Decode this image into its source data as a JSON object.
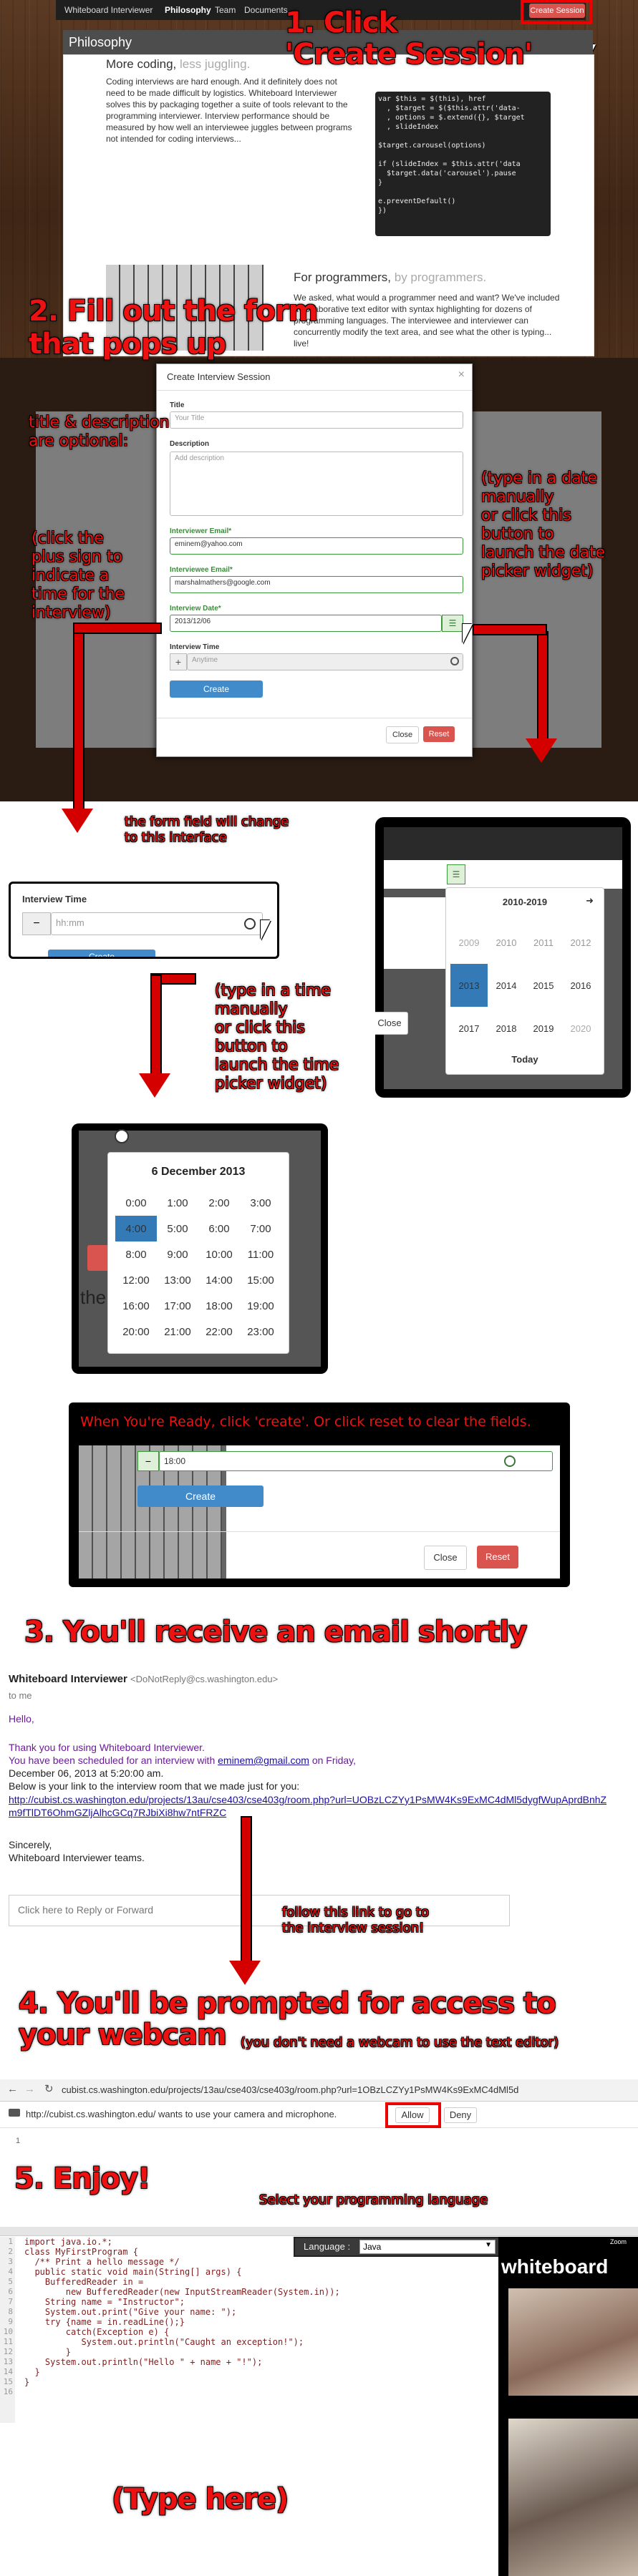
{
  "steps": {
    "s1": "1. Click\n'Create Session'",
    "s2": "2. Fill out the form\nthat pops up",
    "s3": "3. You'll receive an email shortly",
    "s4": "4. You'll be prompted for access to\nyour webcam",
    "s5": "5. Enjoy!"
  },
  "notes": {
    "title_optional": "title & description\nare optional:",
    "plus_sign": "(click the\nplus sign to\nindicate a\ntime for the\ninterview)",
    "date_type": "(type in a date\nmanually\nor click this\nbutton to\nlaunch the date\npicker widget)",
    "form_change": "the form field will change\nto this interface",
    "time_type": "(type in a time\nmanually\nor click this\nbutton to\nlaunch the time\npicker widget)",
    "ready": "When You're Ready, click 'create'. Or click reset to clear the fields.",
    "follow_link": "follow this link to go to\nthe interview session!",
    "webcam_note": "(you don't need a webcam to use the text editor)",
    "select_lang": "Select your programming language",
    "type_here": "(Type here)"
  },
  "site": {
    "brand": "Whiteboard Interviewer",
    "nav": [
      "Philosophy",
      "Team",
      "Documents"
    ],
    "create_session": "Create Session",
    "section_title": "Philosophy",
    "h_more": "More coding,",
    "h_more_sub": " less juggling.",
    "p_more": "Coding interviews are hard enough. And it definitely does not need to be made difficult by logistics. Whiteboard Interviewer solves this by packaging together a suite of tools relevant to the programming interviewer. Interview performance should be measured by how well an interviewee juggles between programs not intended for coding interviews...",
    "h_prog": "For programmers,",
    "h_prog_sub": " by programmers.",
    "p_prog": "We asked, what would a programmer need and want? We've included a collaborative text editor with syntax highlighting for dozens of programming languages. The interviewee and interviewer can concurrently modify the text area, and see what the other is typing... live!",
    "code_lines": "var $this = $(this), href\n  , $target = $($this.attr('data-\n  , options = $.extend({}, $target\n  , slideIndex\n\n$target.carousel(options)\n\nif (slideIndex = $this.attr('data\n  $target.data('carousel').pause\n}\n\ne.preventDefault()\n})"
  },
  "modal": {
    "title": "Create Interview Session",
    "close_x": "×",
    "title_label": "Title",
    "title_placeholder": "Your Title",
    "desc_label": "Description",
    "desc_placeholder": "Add description",
    "er_label": "Interviewer Email*",
    "er_value": "eminem@yahoo.com",
    "ee_label": "Interviewee Email*",
    "ee_value": "marshalmathers@google.com",
    "date_label": "Interview Date*",
    "date_value": "2013/12/06",
    "time_label": "Interview Time",
    "time_value": "Anytime",
    "create": "Create",
    "close": "Close",
    "reset": "Reset"
  },
  "time_field": {
    "label": "Interview Time",
    "minus": "−",
    "placeholder": "hh:mm",
    "create_partial": "Create"
  },
  "date_picker": {
    "range": "2010-2019",
    "next": "➜",
    "years": [
      "2009",
      "2010",
      "2011",
      "2012",
      "2013",
      "2014",
      "2015",
      "2016",
      "2017",
      "2018",
      "2019",
      "2020"
    ],
    "selected": "2013",
    "today": "Today",
    "close": "Close"
  },
  "time_picker": {
    "date": "6 December 2013",
    "times": [
      "0:00",
      "1:00",
      "2:00",
      "3:00",
      "4:00",
      "5:00",
      "6:00",
      "7:00",
      "8:00",
      "9:00",
      "10:00",
      "11:00",
      "12:00",
      "13:00",
      "14:00",
      "15:00",
      "16:00",
      "17:00",
      "18:00",
      "19:00",
      "20:00",
      "21:00",
      "22:00",
      "23:00"
    ],
    "selected": "4:00",
    "side_text": "the"
  },
  "ready_form": {
    "minus": "−",
    "time_value": "18:00",
    "create": "Create",
    "close": "Close",
    "reset": "Reset"
  },
  "email": {
    "sender": "Whiteboard Interviewer",
    "sender_addr": "<DoNotReply@cs.washington.edu>",
    "to": "to me",
    "hello": "Hello,",
    "line1": "Thank you for using Whiteboard Interviewer.",
    "line2_pre": "You have been scheduled for an interview with ",
    "line2_mail": "eminem@gmail.com",
    "line2_post": " on Friday,",
    "line3": "December 06, 2013 at 5:20:00 am.",
    "line4": "Below is your link to the interview room that we made just for you:",
    "url": "http://cubist.cs.washington.edu/projects/13au/cse403/cse403g/room.php?url=UOBzLCZYy1PsMW4Ks9ExMC4dMl5dygfWupAprdBnhZm9fTlDT6OhmGZljAlhcGCq7RJbiXi8hw7ntFRZC",
    "sincerely": "Sincerely,",
    "team": "Whiteboard Interviewer teams.",
    "reply": "Click here to Reply or Forward"
  },
  "browser": {
    "url": "cubist.cs.washington.edu/projects/13au/cse403/cse403g/room.php?url=1OBzLCZYy1PsMW4Ks9ExMC4dMl5d",
    "prompt": "http://cubist.cs.washington.edu/ wants to use your camera and microphone.",
    "allow": "Allow",
    "deny": "Deny",
    "editor_line1": "1"
  },
  "editor": {
    "language_label": "Language :",
    "language": "Java",
    "brand_partial": "whiteboard",
    "zoom": "Zoom",
    "code": "import java.io.*;\nclass MyFirstProgram {\n  /** Print a hello message */\n  public static void main(String[] args) {\n    BufferedReader in =\n        new BufferedReader(new InputStreamReader(System.in));\n    String name = \"Instructor\";\n    System.out.print(\"Give your name: \");\n    try {name = in.readLine();}\n        catch(Exception e) {\n           System.out.println(\"Caught an exception!\");\n        }\n    System.out.println(\"Hello \" + name + \"!\");\n  }\n}",
    "line_numbers": "1\n2\n3\n4\n5\n6\n7\n8\n9\n10\n11\n12\n13\n14\n15\n16"
  }
}
